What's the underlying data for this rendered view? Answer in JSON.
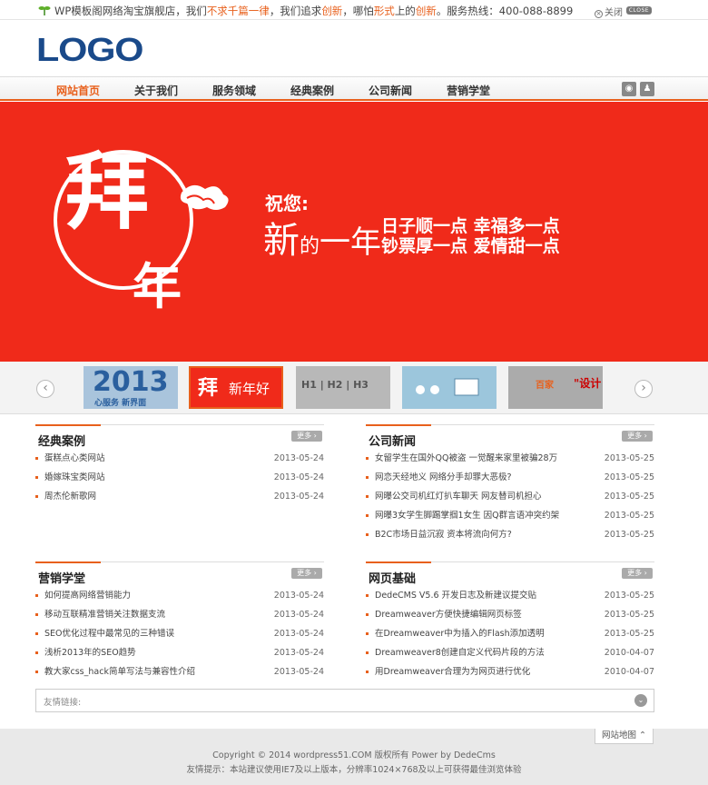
{
  "topbar": {
    "s1": "WP模板阁网络淘宝旗舰店，我们",
    "s2": "不求千篇一律",
    "s3": "，我们追求",
    "s4": "创新",
    "s5": "，哪怕",
    "s6": "形式",
    "s7": "上的",
    "s8": "创新",
    "s9": "。服务热线：400-088-8899",
    "close_label": "关闭",
    "close_btn": "CLOSE"
  },
  "logo": "LOGO",
  "nav": {
    "items": [
      "网站首页",
      "关于我们",
      "服务领域",
      "经典案例",
      "公司新闻",
      "营销学堂"
    ]
  },
  "banner": {
    "bai": "拜",
    "nian": "年",
    "wish": "祝您:",
    "new_year_1": "新",
    "new_year_2": "的",
    "new_year_3": "一年",
    "line1": "日子顺一点 幸福多一点",
    "line2": "钞票厚一点 爱情甜一点"
  },
  "thumbs": {
    "t1": "2013",
    "t1_sub": "心服务 新界面",
    "t2a": "拜",
    "t2b": "新年好",
    "t3": "H1 | H2 | H3",
    "t5a": "百家",
    "t5b": "\"设计"
  },
  "more_label": "更多",
  "sections": {
    "cases": {
      "title": "经典案例",
      "items": [
        {
          "t": "蛋糕点心类网站",
          "d": "2013-05-24"
        },
        {
          "t": "婚嫁珠宝类网站",
          "d": "2013-05-24"
        },
        {
          "t": "周杰伦新歌网",
          "d": "2013-05-24"
        }
      ]
    },
    "news": {
      "title": "公司新闻",
      "items": [
        {
          "t": "女留学生在国外QQ被盗 一觉醒来家里被骗28万",
          "d": "2013-05-25"
        },
        {
          "t": "网恋天经地义 网络分手却罪大恶极?",
          "d": "2013-05-25"
        },
        {
          "t": "网曝公交司机红灯扒车聊天 网友替司机担心",
          "d": "2013-05-25"
        },
        {
          "t": "网曝3女学生脚踢掌掴1女生 因Q群言语冲突约架",
          "d": "2013-05-25"
        },
        {
          "t": "B2C市场日益沉寂 资本将流向何方?",
          "d": "2013-05-25"
        }
      ]
    },
    "marketing": {
      "title": "营销学堂",
      "items": [
        {
          "t": "如何提高网络营销能力",
          "d": "2013-05-24"
        },
        {
          "t": "移动互联精准营销关注数据支流",
          "d": "2013-05-24"
        },
        {
          "t": "SEO优化过程中最常见的三种错误",
          "d": "2013-05-24"
        },
        {
          "t": "浅析2013年的SEO趋势",
          "d": "2013-05-24"
        },
        {
          "t": "教大家css_hack简单写法与兼容性介绍",
          "d": "2013-05-24"
        }
      ]
    },
    "web": {
      "title": "网页基础",
      "items": [
        {
          "t": "DedeCMS V5.6 开发日志及新建议提交贴",
          "d": "2013-05-25"
        },
        {
          "t": "Dreamweaver方便快捷编辑网页标签",
          "d": "2013-05-25"
        },
        {
          "t": "在Dreamweaver中为插入的Flash添加透明",
          "d": "2013-05-25"
        },
        {
          "t": "Dreamweaver8创建自定义代码片段的方法",
          "d": "2010-04-07"
        },
        {
          "t": "用Dreamweaver合理为为网页进行优化",
          "d": "2010-04-07"
        }
      ]
    }
  },
  "friend_links": "友情链接:",
  "sitemap": "网站地图",
  "footer": {
    "copyright": "Copyright © 2014 wordpress51.COM 版权所有 Power by DedeCms",
    "tip": "友情提示：本站建议使用IE7及以上版本，分辨率1024×768及以上可获得最佳浏览体验"
  }
}
